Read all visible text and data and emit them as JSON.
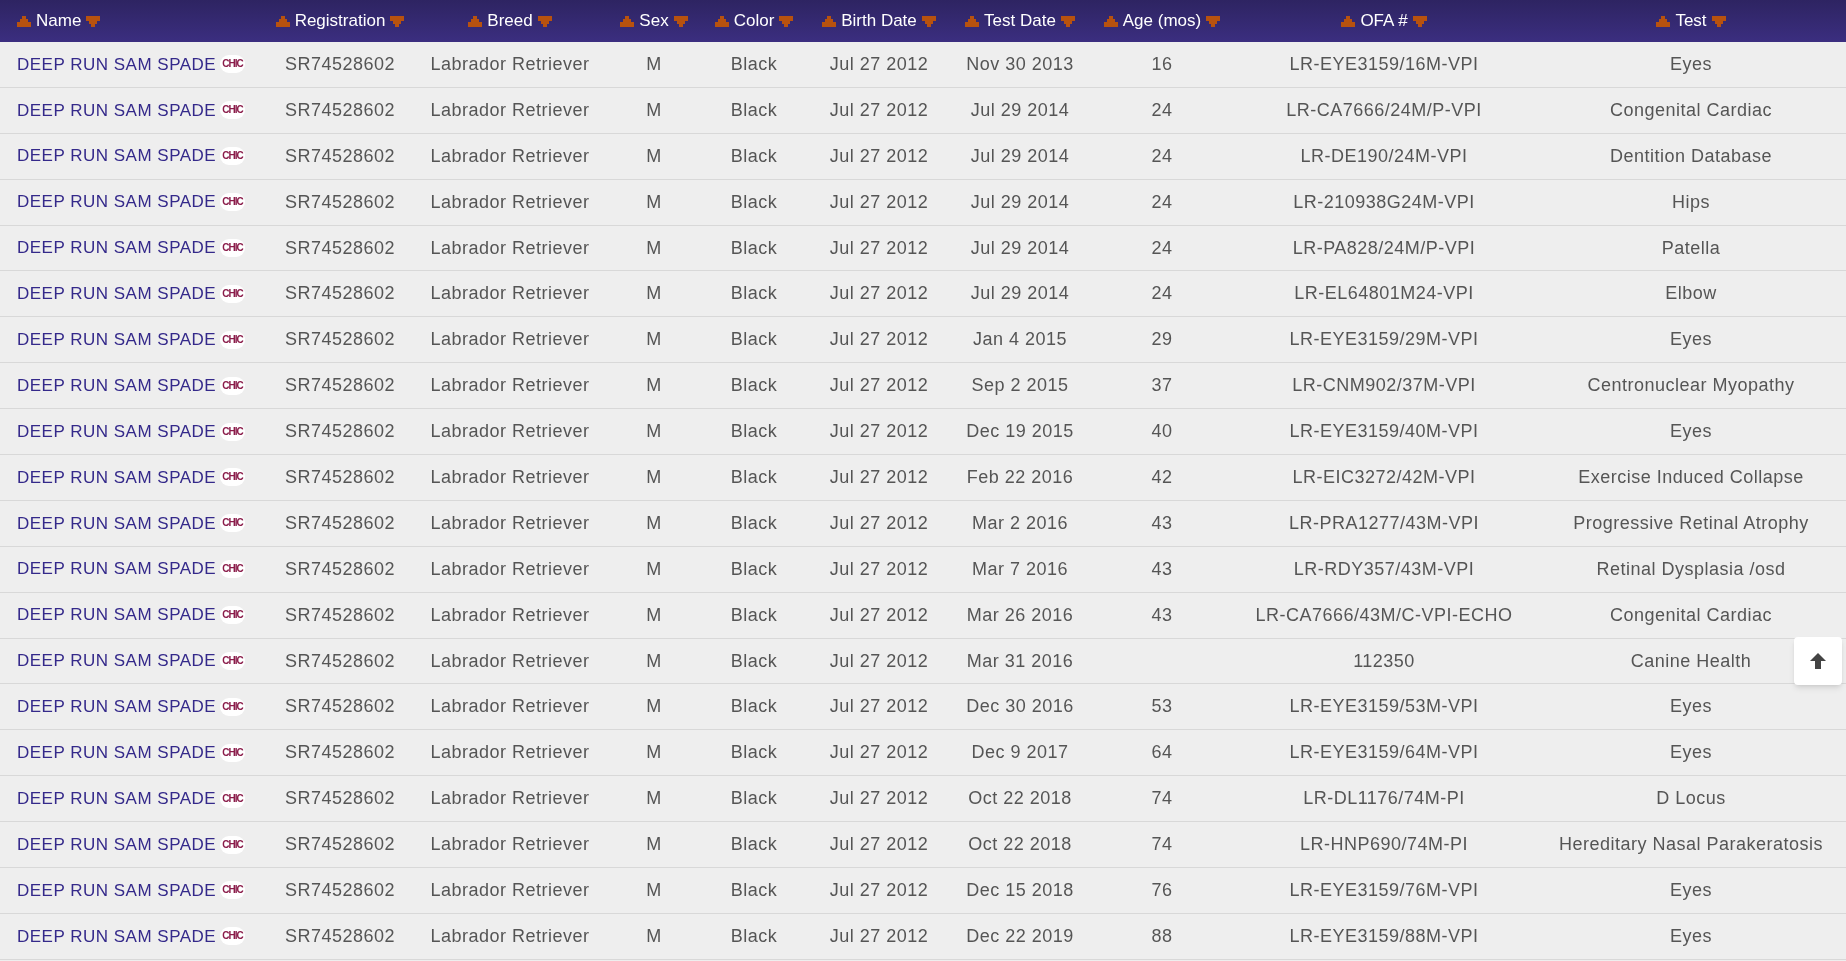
{
  "table": {
    "columns": [
      "Name",
      "Registration",
      "Breed",
      "Sex",
      "Color",
      "Birth Date",
      "Test Date",
      "Age (mos)",
      "OFA #",
      "Test"
    ],
    "rows": [
      {
        "badge": "CHIC",
        "cells": [
          "DEEP RUN SAM SPADE",
          "SR74528602",
          "Labrador Retriever",
          "M",
          "Black",
          "Jul 27 2012",
          "Nov 30 2013",
          "16",
          "LR-EYE3159/16M-VPI",
          "Eyes"
        ]
      },
      {
        "badge": "CHIC",
        "cells": [
          "DEEP RUN SAM SPADE",
          "SR74528602",
          "Labrador Retriever",
          "M",
          "Black",
          "Jul 27 2012",
          "Jul 29 2014",
          "24",
          "LR-CA7666/24M/P-VPI",
          "Congenital Cardiac"
        ]
      },
      {
        "badge": "CHIC",
        "cells": [
          "DEEP RUN SAM SPADE",
          "SR74528602",
          "Labrador Retriever",
          "M",
          "Black",
          "Jul 27 2012",
          "Jul 29 2014",
          "24",
          "LR-DE190/24M-VPI",
          "Dentition Database"
        ]
      },
      {
        "badge": "CHIC",
        "cells": [
          "DEEP RUN SAM SPADE",
          "SR74528602",
          "Labrador Retriever",
          "M",
          "Black",
          "Jul 27 2012",
          "Jul 29 2014",
          "24",
          "LR-210938G24M-VPI",
          "Hips"
        ]
      },
      {
        "badge": "CHIC",
        "cells": [
          "DEEP RUN SAM SPADE",
          "SR74528602",
          "Labrador Retriever",
          "M",
          "Black",
          "Jul 27 2012",
          "Jul 29 2014",
          "24",
          "LR-PA828/24M/P-VPI",
          "Patella"
        ]
      },
      {
        "badge": "CHIC",
        "cells": [
          "DEEP RUN SAM SPADE",
          "SR74528602",
          "Labrador Retriever",
          "M",
          "Black",
          "Jul 27 2012",
          "Jul 29 2014",
          "24",
          "LR-EL64801M24-VPI",
          "Elbow"
        ]
      },
      {
        "badge": "CHIC",
        "cells": [
          "DEEP RUN SAM SPADE",
          "SR74528602",
          "Labrador Retriever",
          "M",
          "Black",
          "Jul 27 2012",
          "Jan 4 2015",
          "29",
          "LR-EYE3159/29M-VPI",
          "Eyes"
        ]
      },
      {
        "badge": "CHIC",
        "cells": [
          "DEEP RUN SAM SPADE",
          "SR74528602",
          "Labrador Retriever",
          "M",
          "Black",
          "Jul 27 2012",
          "Sep 2 2015",
          "37",
          "LR-CNM902/37M-VPI",
          "Centronuclear Myopathy"
        ]
      },
      {
        "badge": "CHIC",
        "cells": [
          "DEEP RUN SAM SPADE",
          "SR74528602",
          "Labrador Retriever",
          "M",
          "Black",
          "Jul 27 2012",
          "Dec 19 2015",
          "40",
          "LR-EYE3159/40M-VPI",
          "Eyes"
        ]
      },
      {
        "badge": "CHIC",
        "cells": [
          "DEEP RUN SAM SPADE",
          "SR74528602",
          "Labrador Retriever",
          "M",
          "Black",
          "Jul 27 2012",
          "Feb 22 2016",
          "42",
          "LR-EIC3272/42M-VPI",
          "Exercise Induced Collapse"
        ]
      },
      {
        "badge": "CHIC",
        "cells": [
          "DEEP RUN SAM SPADE",
          "SR74528602",
          "Labrador Retriever",
          "M",
          "Black",
          "Jul 27 2012",
          "Mar 2 2016",
          "43",
          "LR-PRA1277/43M-VPI",
          "Progressive Retinal Atrophy"
        ]
      },
      {
        "badge": "CHIC",
        "cells": [
          "DEEP RUN SAM SPADE",
          "SR74528602",
          "Labrador Retriever",
          "M",
          "Black",
          "Jul 27 2012",
          "Mar 7 2016",
          "43",
          "LR-RDY357/43M-VPI",
          "Retinal Dysplasia /osd"
        ]
      },
      {
        "badge": "CHIC",
        "cells": [
          "DEEP RUN SAM SPADE",
          "SR74528602",
          "Labrador Retriever",
          "M",
          "Black",
          "Jul 27 2012",
          "Mar 26 2016",
          "43",
          "LR-CA7666/43M/C-VPI-ECHO",
          "Congenital Cardiac"
        ]
      },
      {
        "badge": "CHIC",
        "cells": [
          "DEEP RUN SAM SPADE",
          "SR74528602",
          "Labrador Retriever",
          "M",
          "Black",
          "Jul 27 2012",
          "Mar 31 2016",
          "",
          "112350",
          "Canine Health"
        ]
      },
      {
        "badge": "CHIC",
        "cells": [
          "DEEP RUN SAM SPADE",
          "SR74528602",
          "Labrador Retriever",
          "M",
          "Black",
          "Jul 27 2012",
          "Dec 30 2016",
          "53",
          "LR-EYE3159/53M-VPI",
          "Eyes"
        ]
      },
      {
        "badge": "CHIC",
        "cells": [
          "DEEP RUN SAM SPADE",
          "SR74528602",
          "Labrador Retriever",
          "M",
          "Black",
          "Jul 27 2012",
          "Dec 9 2017",
          "64",
          "LR-EYE3159/64M-VPI",
          "Eyes"
        ]
      },
      {
        "badge": "CHIC",
        "cells": [
          "DEEP RUN SAM SPADE",
          "SR74528602",
          "Labrador Retriever",
          "M",
          "Black",
          "Jul 27 2012",
          "Oct 22 2018",
          "74",
          "LR-DL1176/74M-PI",
          "D Locus"
        ]
      },
      {
        "badge": "CHIC",
        "cells": [
          "DEEP RUN SAM SPADE",
          "SR74528602",
          "Labrador Retriever",
          "M",
          "Black",
          "Jul 27 2012",
          "Oct 22 2018",
          "74",
          "LR-HNP690/74M-PI",
          "Hereditary Nasal Parakeratosis"
        ]
      },
      {
        "badge": "CHIC",
        "cells": [
          "DEEP RUN SAM SPADE",
          "SR74528602",
          "Labrador Retriever",
          "M",
          "Black",
          "Jul 27 2012",
          "Dec 15 2018",
          "76",
          "LR-EYE3159/76M-VPI",
          "Eyes"
        ]
      },
      {
        "badge": "CHIC",
        "cells": [
          "DEEP RUN SAM SPADE",
          "SR74528602",
          "Labrador Retriever",
          "M",
          "Black",
          "Jul 27 2012",
          "Dec 22 2019",
          "88",
          "LR-EYE3159/88M-VPI",
          "Eyes"
        ]
      }
    ]
  }
}
